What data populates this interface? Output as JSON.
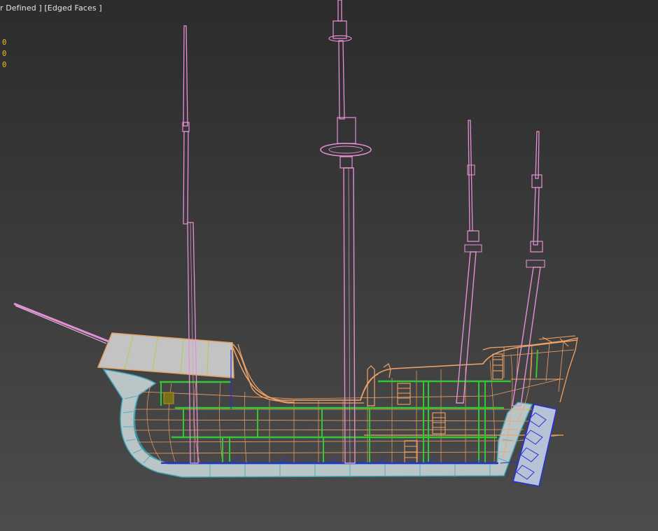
{
  "viewport": {
    "label": "r Defined ] [Edged Faces ]",
    "stats": [
      "0",
      "0",
      "0"
    ]
  },
  "colors": {
    "background_top": "#2c2c2c",
    "background_bottom": "#4c4c4c",
    "label_text": "#e6e6e6",
    "stats_text": "#f0c020",
    "masts": "#e58fd6",
    "hull_wireframe": "#f0a266",
    "deck_beams": "#34c734",
    "keel_rudder": "#2a2ed8",
    "hull_shell": "#b8c8c8",
    "hull_outline": "#3aa6b8",
    "forecastle_roof": "#c8c8c8"
  }
}
